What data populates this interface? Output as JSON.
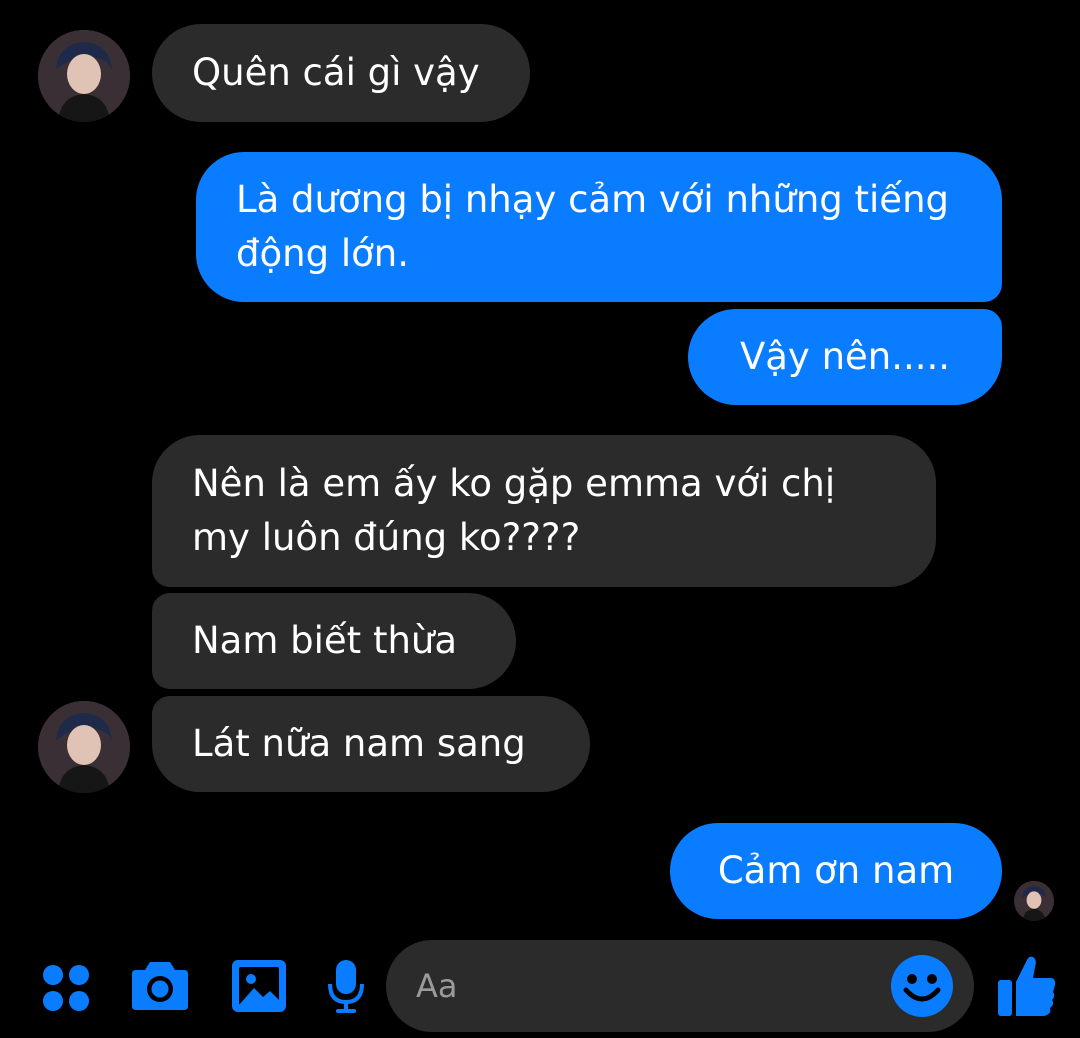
{
  "theme": {
    "accent": "#0a7cff",
    "received_bubble": "#2b2b2b",
    "background": "#000000"
  },
  "messages": [
    {
      "sender": "other",
      "text": "Quên cái gì vậy"
    },
    {
      "sender": "me",
      "text": "Là dương bị nhạy cảm với những tiếng động lớn."
    },
    {
      "sender": "me",
      "text": "Vậy nên....."
    },
    {
      "sender": "other",
      "text": "Nên là em ấy ko gặp emma với chị my luôn đúng ko????"
    },
    {
      "sender": "other",
      "text": "Nam biết thừa"
    },
    {
      "sender": "other",
      "text": "Lát nữa nam sang"
    },
    {
      "sender": "me",
      "text": "Cảm ơn nam"
    }
  ],
  "composer": {
    "placeholder": "Aa"
  },
  "toolbar": {
    "icons": [
      "apps-icon",
      "camera-icon",
      "gallery-icon",
      "microphone-icon",
      "emoji-icon",
      "like-thumb-icon"
    ]
  }
}
